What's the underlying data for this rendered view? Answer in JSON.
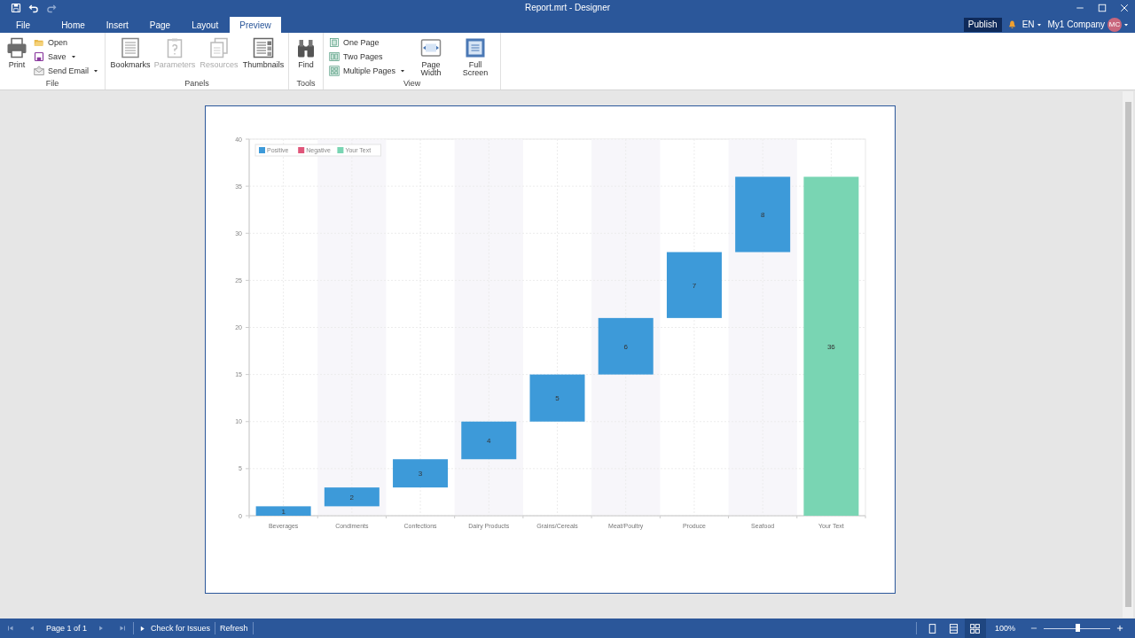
{
  "window": {
    "title": "Report.mrt - Designer"
  },
  "quick_access": [
    {
      "disabled": false
    },
    {
      "disabled": false
    },
    {
      "disabled": true
    }
  ],
  "tabs": [
    {
      "label": "File",
      "selected": false
    },
    {
      "label": "Home",
      "selected": false
    },
    {
      "label": "Insert",
      "selected": false
    },
    {
      "label": "Page",
      "selected": false
    },
    {
      "label": "Layout",
      "selected": false
    },
    {
      "label": "Preview",
      "selected": true
    }
  ],
  "account": {
    "publish": "Publish",
    "language": "EN",
    "user": "My1 Company",
    "initials": "MC"
  },
  "ribbon": {
    "groups": [
      {
        "label": "File",
        "items": [
          {
            "kind": "large",
            "label": "Print",
            "disabled": false
          },
          {
            "kind": "small",
            "label": "Open",
            "disabled": false,
            "dropdown": false
          },
          {
            "kind": "small",
            "label": "Save",
            "disabled": false,
            "dropdown": true
          },
          {
            "kind": "small",
            "label": "Send Email",
            "disabled": false,
            "dropdown": true
          }
        ]
      },
      {
        "label": "Panels",
        "items": [
          {
            "kind": "large",
            "label": "Bookmarks",
            "disabled": false
          },
          {
            "kind": "large",
            "label": "Parameters",
            "disabled": true
          },
          {
            "kind": "large",
            "label": "Resources",
            "disabled": true
          },
          {
            "kind": "large",
            "label": "Thumbnails",
            "disabled": false
          }
        ]
      },
      {
        "label": "Tools",
        "items": [
          {
            "kind": "large",
            "label": "Find",
            "disabled": false
          }
        ]
      },
      {
        "label": "View",
        "items": [
          {
            "kind": "small",
            "label": "One Page",
            "disabled": false,
            "dropdown": false
          },
          {
            "kind": "small",
            "label": "Two Pages",
            "disabled": false,
            "dropdown": false
          },
          {
            "kind": "small",
            "label": "Multiple Pages",
            "disabled": false,
            "dropdown": true
          },
          {
            "kind": "large",
            "label": "Page Width",
            "disabled": false
          },
          {
            "kind": "large",
            "label": "Full Screen",
            "disabled": false
          }
        ]
      }
    ]
  },
  "preview": {
    "chart_data": {
      "type": "candlestick",
      "categories": [
        "Beverages",
        "Condiments",
        "Confections",
        "Dairy Products",
        "Grains/Cereals",
        "Meat/Poultry",
        "Produce",
        "Seafood",
        "Your Text"
      ],
      "series": [
        {
          "name": "Positive",
          "color": "#3d9ad9",
          "ohlc": [
            [
              0,
              1,
              0,
              1
            ],
            [
              1,
              3,
              1,
              3
            ],
            [
              3,
              6,
              3,
              6
            ],
            [
              6,
              10,
              6,
              10
            ],
            [
              10,
              15,
              10,
              15
            ],
            [
              15,
              21,
              15,
              21
            ],
            [
              21,
              28,
              21,
              28
            ],
            [
              28,
              36,
              28,
              36
            ],
            null
          ]
        },
        {
          "name": "Negative",
          "color": "#e0567a",
          "ohlc": [
            null,
            null,
            null,
            null,
            null,
            null,
            null,
            null,
            null
          ]
        },
        {
          "name": "Your Text",
          "color": "#79d5b3",
          "ohlc": [
            null,
            null,
            null,
            null,
            null,
            null,
            null,
            null,
            [
              0,
              36,
              0,
              36
            ]
          ]
        }
      ],
      "ylim": [
        0,
        40
      ],
      "yticks": [
        0,
        5,
        10,
        15,
        20,
        25,
        30,
        35,
        40
      ],
      "grid": true,
      "legend": "top-left",
      "value_labels": [
        "1",
        "2",
        "3",
        "4",
        "5",
        "6",
        "7",
        "8",
        "36"
      ]
    }
  },
  "status_bar": {
    "page_label": "Page 1 of 1",
    "actions": [
      "Check for Issues",
      "Refresh"
    ],
    "view_modes": [
      {
        "selected": false
      },
      {
        "selected": false
      },
      {
        "selected": true
      }
    ],
    "zoom": "100%",
    "zoom_slider": {
      "level": 0.5
    }
  }
}
